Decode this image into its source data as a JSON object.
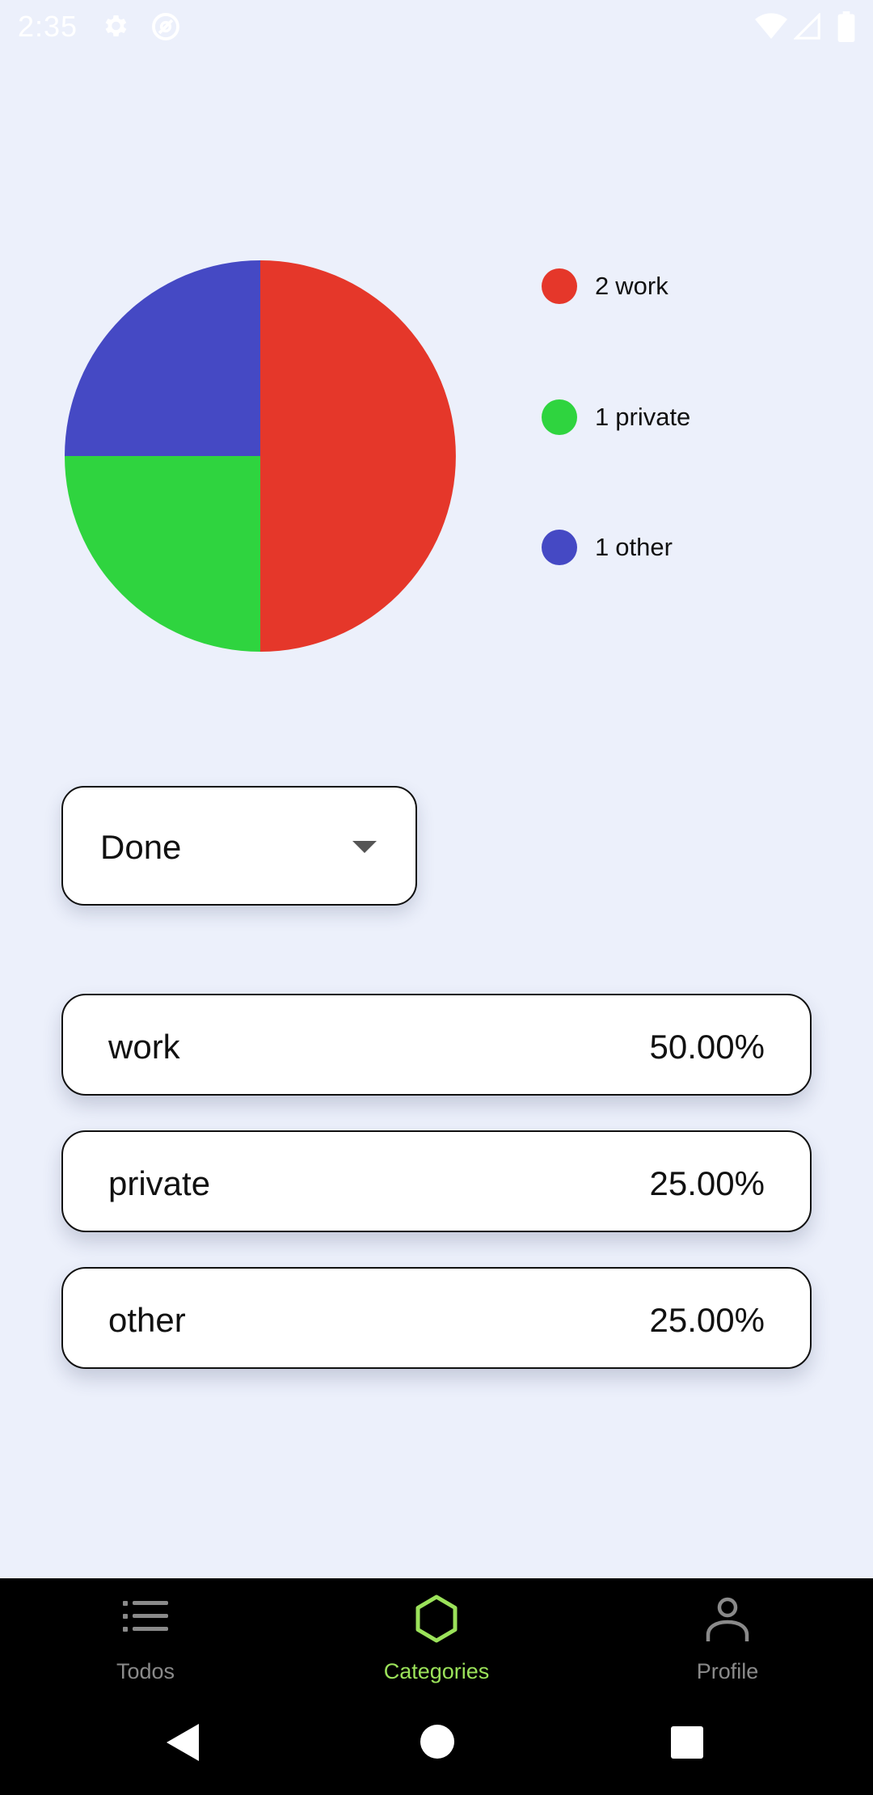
{
  "status_bar": {
    "time": "2:35",
    "icons": [
      "settings-icon",
      "at-sign-icon",
      "wifi-icon",
      "signal-icon",
      "battery-icon"
    ]
  },
  "chart_data": {
    "type": "pie",
    "slices": [
      {
        "label": "work",
        "value": 2,
        "color": "#e5372a"
      },
      {
        "label": "private",
        "value": 1,
        "color": "#2fd43f"
      },
      {
        "label": "other",
        "value": 1,
        "color": "#4549c4"
      }
    ],
    "legend_placement": "right",
    "legend": [
      {
        "count": "2",
        "name": "work"
      },
      {
        "count": "1",
        "name": "private"
      },
      {
        "count": "1",
        "name": "other"
      }
    ]
  },
  "filter": {
    "selected": "Done",
    "icon": "caret-down-icon"
  },
  "categories": [
    {
      "name": "work",
      "percent": "50.00%"
    },
    {
      "name": "private",
      "percent": "25.00%"
    },
    {
      "name": "other",
      "percent": "25.00%"
    }
  ],
  "bottom_nav": {
    "items": [
      {
        "label": "Todos",
        "icon": "list-icon",
        "active": false
      },
      {
        "label": "Categories",
        "icon": "hexagon-icon",
        "active": true
      },
      {
        "label": "Profile",
        "icon": "person-icon",
        "active": false
      }
    ],
    "active_color": "#9be25a",
    "inactive_color": "#8a8a8a"
  },
  "system_nav": {
    "icons": [
      "back-icon",
      "home-icon",
      "recents-icon"
    ]
  }
}
